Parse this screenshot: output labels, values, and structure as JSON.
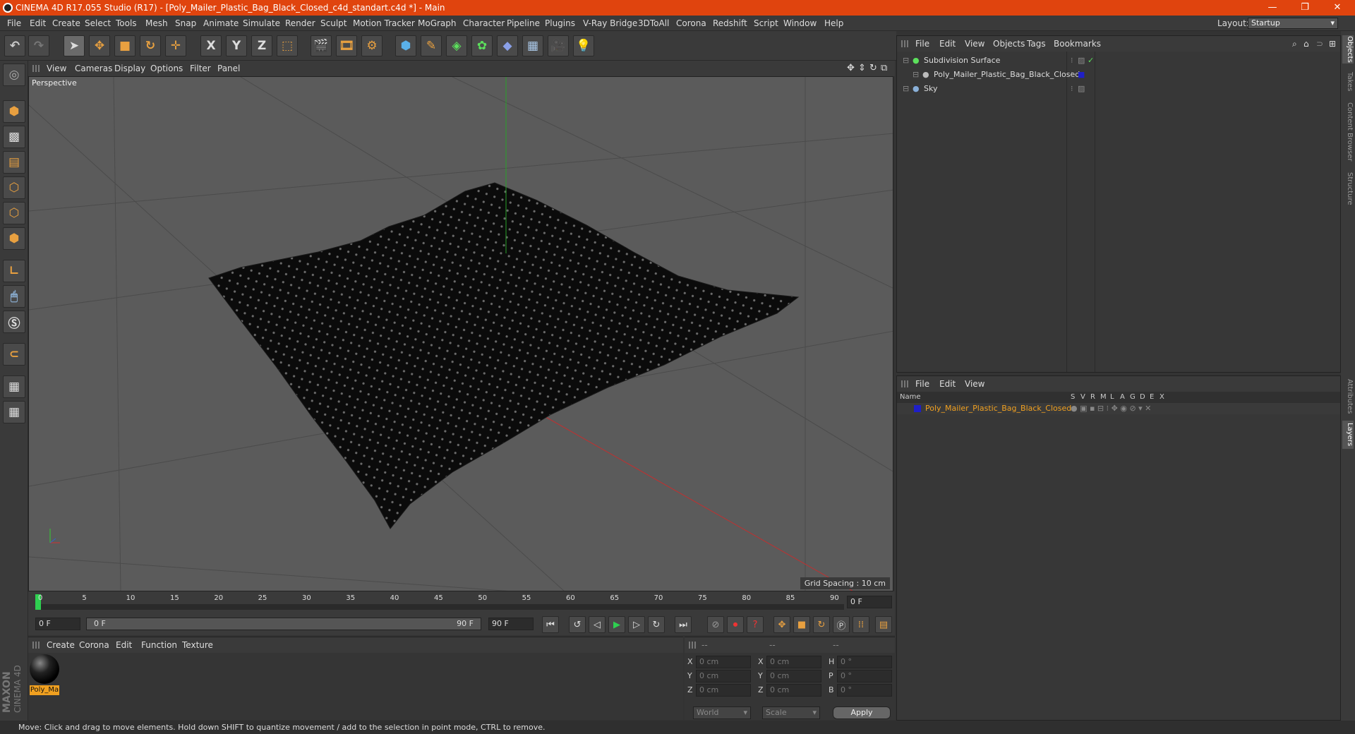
{
  "titlebar": {
    "title": "CINEMA 4D R17.055 Studio (R17) - [Poly_Mailer_Plastic_Bag_Black_Closed_c4d_standart.c4d *] - Main"
  },
  "menu": [
    "File",
    "Edit",
    "Create",
    "Select",
    "Tools",
    "Mesh",
    "Snap",
    "Animate",
    "Simulate",
    "Render",
    "Sculpt",
    "Motion Tracker",
    "MoGraph",
    "Character",
    "Pipeline",
    "Plugins",
    "V-Ray Bridge",
    "3DToAll",
    "Corona",
    "Redshift",
    "Script",
    "Window",
    "Help"
  ],
  "layout": {
    "label": "Layout:",
    "value": "Startup"
  },
  "toolbar": {
    "x": "X",
    "y": "Y",
    "z": "Z"
  },
  "viewport": {
    "menu": [
      "View",
      "Cameras",
      "Display",
      "Options",
      "Filter",
      "Panel"
    ],
    "label": "Perspective",
    "grid_spacing": "Grid Spacing : 10 cm"
  },
  "timeline": {
    "ticks": [
      "0",
      "5",
      "10",
      "15",
      "20",
      "25",
      "30",
      "35",
      "40",
      "45",
      "50",
      "55",
      "60",
      "65",
      "70",
      "75",
      "80",
      "85",
      "90"
    ],
    "current": "0 F",
    "start": "0 F",
    "range_start": "0 F",
    "range_end": "90 F",
    "end": "90 F"
  },
  "material_manager": {
    "menu": [
      "Create",
      "Corona",
      "Edit",
      "Function",
      "Texture"
    ],
    "material_label": "Poly_Ma"
  },
  "coords": {
    "header": [
      "--",
      "--",
      "--"
    ],
    "rows": [
      {
        "a": "X",
        "av": "0 cm",
        "b": "X",
        "bv": "0 cm",
        "c": "H",
        "cv": "0 °"
      },
      {
        "a": "Y",
        "av": "0 cm",
        "b": "Y",
        "bv": "0 cm",
        "c": "P",
        "cv": "0 °"
      },
      {
        "a": "Z",
        "av": "0 cm",
        "b": "Z",
        "bv": "0 cm",
        "c": "B",
        "cv": "0 °"
      }
    ],
    "world": "World",
    "scale": "Scale",
    "apply": "Apply"
  },
  "object_manager": {
    "menu": [
      "File",
      "Edit",
      "View",
      "Objects",
      "Tags",
      "Bookmarks"
    ],
    "objects": [
      {
        "name": "Subdivision Surface",
        "indent": 0
      },
      {
        "name": "Poly_Mailer_Plastic_Bag_Black_Closed",
        "indent": 1
      },
      {
        "name": "Sky",
        "indent": 0
      }
    ]
  },
  "layer_manager": {
    "menu": [
      "File",
      "Edit",
      "View"
    ],
    "col_name": "Name",
    "cols": [
      "S",
      "V",
      "R",
      "M",
      "L",
      "A",
      "G",
      "D",
      "E",
      "X"
    ],
    "layer": "Poly_Mailer_Plastic_Bag_Black_Closed"
  },
  "right_tabs": [
    "Objects",
    "Takes",
    "Content Browser",
    "Structure",
    "Attributes",
    "Layers"
  ],
  "status": "Move: Click and drag to move elements. Hold down SHIFT to quantize movement / add to the selection in point mode, CTRL to remove.",
  "brand": {
    "line1": "MAXON",
    "line2": "CINEMA 4D"
  },
  "colors": {
    "title_bg": "#e0440e",
    "accent": "#f0a020",
    "layer_color": "#1f1fc8"
  }
}
